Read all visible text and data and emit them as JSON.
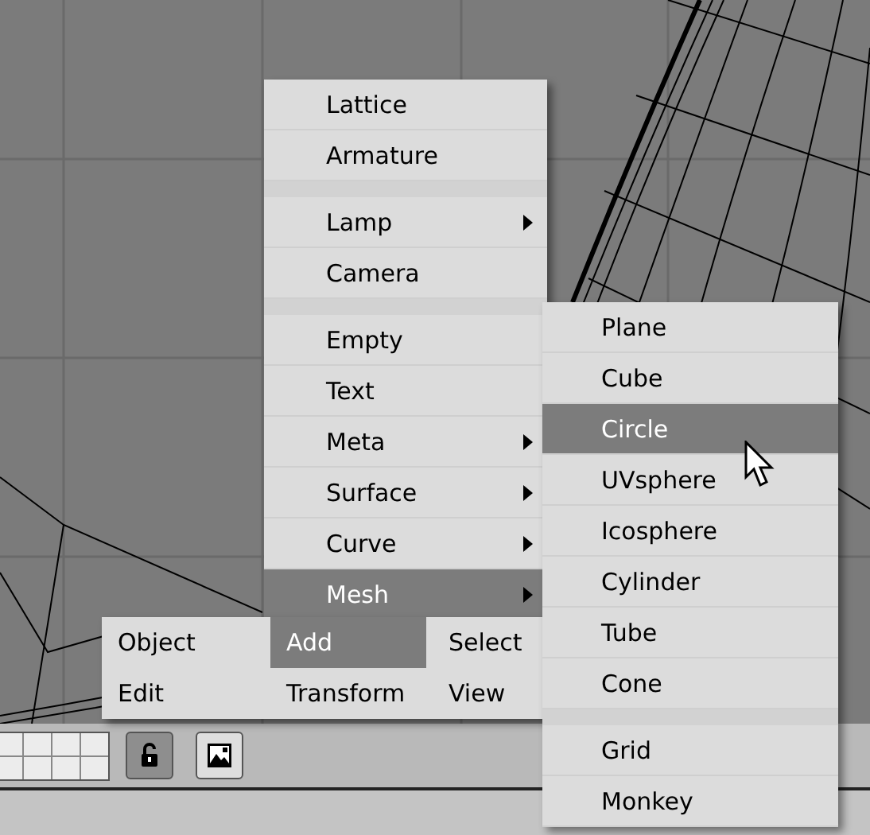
{
  "add_menu": {
    "items": [
      {
        "kind": "item",
        "label": "Lattice",
        "submenu": false,
        "selected": false
      },
      {
        "kind": "item",
        "label": "Armature",
        "submenu": false,
        "selected": false
      },
      {
        "kind": "separator"
      },
      {
        "kind": "item",
        "label": "Lamp",
        "submenu": true,
        "selected": false
      },
      {
        "kind": "item",
        "label": "Camera",
        "submenu": false,
        "selected": false
      },
      {
        "kind": "separator"
      },
      {
        "kind": "item",
        "label": "Empty",
        "submenu": false,
        "selected": false
      },
      {
        "kind": "item",
        "label": "Text",
        "submenu": false,
        "selected": false
      },
      {
        "kind": "item",
        "label": "Meta",
        "submenu": true,
        "selected": false
      },
      {
        "kind": "item",
        "label": "Surface",
        "submenu": true,
        "selected": false
      },
      {
        "kind": "item",
        "label": "Curve",
        "submenu": true,
        "selected": false
      },
      {
        "kind": "item",
        "label": "Mesh",
        "submenu": true,
        "selected": true
      }
    ]
  },
  "menu_bar": {
    "rows": [
      [
        {
          "label": "Object",
          "selected": false
        },
        {
          "label": "Add",
          "selected": true
        },
        {
          "label": "Select",
          "selected": false
        }
      ],
      [
        {
          "label": "Edit",
          "selected": false
        },
        {
          "label": "Transform",
          "selected": false
        },
        {
          "label": "View",
          "selected": false
        }
      ]
    ]
  },
  "mesh_menu": {
    "items": [
      {
        "kind": "item",
        "label": "Plane",
        "selected": false
      },
      {
        "kind": "item",
        "label": "Cube",
        "selected": false
      },
      {
        "kind": "item",
        "label": "Circle",
        "selected": true
      },
      {
        "kind": "item",
        "label": "UVsphere",
        "selected": false
      },
      {
        "kind": "item",
        "label": "Icosphere",
        "selected": false
      },
      {
        "kind": "item",
        "label": "Cylinder",
        "selected": false
      },
      {
        "kind": "item",
        "label": "Tube",
        "selected": false
      },
      {
        "kind": "item",
        "label": "Cone",
        "selected": false
      },
      {
        "kind": "separator"
      },
      {
        "kind": "item",
        "label": "Grid",
        "selected": false
      },
      {
        "kind": "item",
        "label": "Monkey",
        "selected": false
      }
    ]
  },
  "header": {
    "lock_pressed": true
  }
}
